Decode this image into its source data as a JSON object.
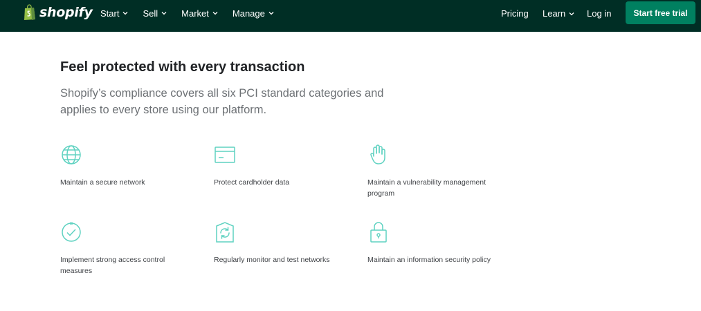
{
  "header": {
    "brand": "shopify",
    "nav_left": [
      {
        "label": "Start"
      },
      {
        "label": "Sell"
      },
      {
        "label": "Market"
      },
      {
        "label": "Manage"
      }
    ],
    "pricing": "Pricing",
    "learn": "Learn",
    "login": "Log in",
    "cta": "Start free trial",
    "colors": {
      "bar": "#002e25",
      "cta": "#008060",
      "logo": "#95bf47"
    }
  },
  "main": {
    "title": "Feel protected with every transaction",
    "lead": "Shopify’s compliance covers all six PCI standard categories and applies to every store using our platform.",
    "features": [
      {
        "icon": "globe-icon",
        "label": "Maintain a secure network"
      },
      {
        "icon": "card-icon",
        "label": "Protect cardholder data"
      },
      {
        "icon": "hand-icon",
        "label": "Maintain a vulnerability management program"
      },
      {
        "icon": "check-circle-icon",
        "label": "Implement strong access control measures"
      },
      {
        "icon": "refresh-shield-icon",
        "label": "Regularly monitor and test networks"
      },
      {
        "icon": "lock-icon",
        "label": "Maintain an information security policy"
      }
    ],
    "icon_color": "#5fd2c1"
  }
}
